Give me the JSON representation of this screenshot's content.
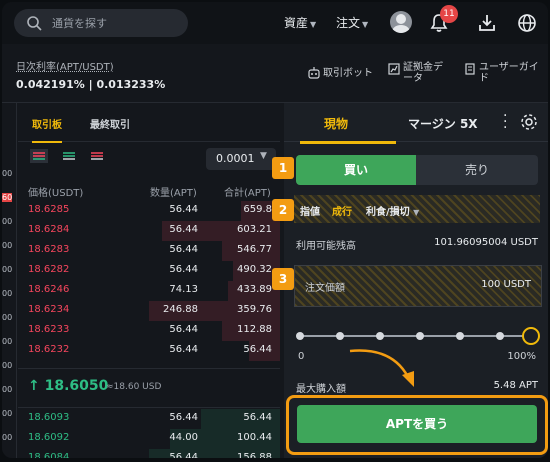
{
  "topbar": {
    "search_placeholder": "通貨を探す",
    "nav": [
      {
        "label": "資産"
      },
      {
        "label": "注文"
      }
    ],
    "notification_count": "11"
  },
  "info": {
    "rate_label": "日次利率(APT/USDT)",
    "rate_value": "0.042191% | 0.013233%",
    "tools": [
      {
        "label": "取引ボット"
      },
      {
        "label": "証拠金データ"
      },
      {
        "label": "ユーザーガイド"
      }
    ]
  },
  "left_column": {
    "ticks": [
      "00",
      "60",
      "00",
      "00",
      "00",
      "00",
      "00",
      "00",
      "00",
      "00",
      "00",
      "00"
    ]
  },
  "orderbook": {
    "tabs": [
      {
        "label": "取引板"
      },
      {
        "label": "最終取引"
      }
    ],
    "precision": "0.0001",
    "headers": {
      "price": "価格(USDT)",
      "amount": "数量(APT)",
      "total": "合計(APT)"
    },
    "asks": [
      {
        "price": "18.6285",
        "amount": "56.44",
        "total": "659.8",
        "depth": 0.15
      },
      {
        "price": "18.6284",
        "amount": "56.44",
        "total": "603.21",
        "depth": 0.45
      },
      {
        "price": "18.6283",
        "amount": "56.44",
        "total": "546.77",
        "depth": 0.22
      },
      {
        "price": "18.6282",
        "amount": "56.44",
        "total": "490.32",
        "depth": 0.18
      },
      {
        "price": "18.6246",
        "amount": "74.13",
        "total": "433.89",
        "depth": 0.2
      },
      {
        "price": "18.6234",
        "amount": "246.88",
        "total": "359.76",
        "depth": 0.5
      },
      {
        "price": "18.6233",
        "amount": "56.44",
        "total": "112.88",
        "depth": 0.22
      },
      {
        "price": "18.6232",
        "amount": "56.44",
        "total": "56.44",
        "depth": 0.12
      }
    ],
    "mid": {
      "arrow": "↑",
      "price": "18.6050",
      "usd": "≈18.60 USD"
    },
    "bids": [
      {
        "price": "18.6093",
        "amount": "56.44",
        "total": "56.44",
        "depth": 0.3
      },
      {
        "price": "18.6092",
        "amount": "44.00",
        "total": "100.44",
        "depth": 0.42
      },
      {
        "price": "18.6084",
        "amount": "56.44",
        "total": "156.88",
        "depth": 0.5
      }
    ]
  },
  "panel": {
    "tabs": [
      {
        "label": "現物"
      },
      {
        "label": "マージン 5X"
      }
    ],
    "buy_label": "買い",
    "sell_label": "売り",
    "order_types": [
      {
        "label": "指値"
      },
      {
        "label": "成行"
      },
      {
        "label": "利食/損切"
      }
    ],
    "available_label": "利用可能残高",
    "available_value": "101.96095004 USDT",
    "amount_label": "注文価額",
    "amount_value": "100 USDT",
    "slider_min": "0",
    "slider_max": "100%",
    "slider_percent": 100,
    "max_label": "最大購入額",
    "max_value": "5.48 APT",
    "cta_label": "APTを買う",
    "steps": [
      "1",
      "2",
      "3"
    ]
  },
  "colors": {
    "accent": "#f0b90b",
    "buy": "#3ea65a",
    "ask": "#f6465d",
    "bid": "#2ebd85",
    "highlight": "#f39c12"
  }
}
